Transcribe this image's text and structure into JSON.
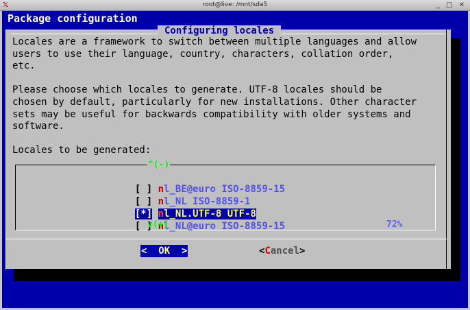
{
  "window": {
    "title": "root@live: /mnt/sda5",
    "controls": "_ □ ✕"
  },
  "backtitle": "Package configuration",
  "dialog": {
    "title": "Configuring locales",
    "description": "Locales are a framework to switch between multiple languages and allow\nusers to use their language, country, characters, collation order,\netc.\n\nPlease choose which locales to generate. UTF-8 locales should be\nchosen by default, particularly for new installations. Other character\nsets may be useful for backwards compatibility with older systems and\nsoftware.\n\nLocales to be generated:",
    "scroll_up": "^(-)",
    "scroll_down": "v(+)",
    "scroll_percent": "72%",
    "items": [
      {
        "check": "[ ]",
        "hot": "n",
        "rest": "l_BE@euro ISO-8859-15",
        "selected": false
      },
      {
        "check": "[ ]",
        "hot": "n",
        "rest": "l_NL ISO-8859-1",
        "selected": false
      },
      {
        "check": "[*]",
        "hot": "n",
        "rest": "l_NL.UTF-8 UTF-8",
        "selected": true
      },
      {
        "check": "[ ]",
        "hot": "n",
        "rest": "l_NL@euro ISO-8859-15",
        "selected": false
      }
    ],
    "ok_button": {
      "left": "<  ",
      "pre": "O",
      "hot": "K",
      "right": "  >"
    },
    "cancel_button": {
      "open": "<",
      "hot": "C",
      "rest": "ancel",
      "close": ">"
    }
  }
}
